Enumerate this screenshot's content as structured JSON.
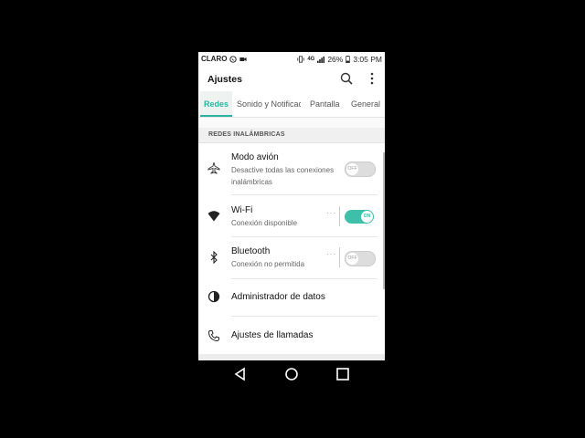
{
  "status_bar": {
    "carrier": "CLARO",
    "network": "4G",
    "battery": "26%",
    "time": "3:05 PM"
  },
  "app_bar": {
    "title": "Ajustes",
    "icons": [
      "search-icon",
      "more-vert-icon"
    ]
  },
  "tabs": [
    {
      "label": "Redes",
      "active": true
    },
    {
      "label": "Sonido y Notificaciones",
      "active": false
    },
    {
      "label": "Pantalla",
      "active": false
    },
    {
      "label": "General",
      "active": false
    }
  ],
  "section_header": "REDES INALÁMBRICAS",
  "items": [
    {
      "icon": "airplane-icon",
      "title": "Modo avión",
      "subtitle": "Desactive todas las conexiones inalámbricas",
      "toggle": "OFF"
    },
    {
      "icon": "wifi-icon",
      "title": "Wi-Fi",
      "subtitle": "Conexión disponible",
      "toggle": "ON"
    },
    {
      "icon": "bluetooth-icon",
      "title": "Bluetooth",
      "subtitle": "Conexión no permitida",
      "toggle": "OFF"
    },
    {
      "icon": "data-usage-icon",
      "title": "Administrador de datos"
    },
    {
      "icon": "phone-icon",
      "title": "Ajustes de llamadas"
    }
  ],
  "nav_bar": [
    "back-icon",
    "home-icon",
    "recents-icon"
  ],
  "colors": {
    "accent": "#2bb3a0",
    "toggle_on": "#3dbfaa"
  }
}
